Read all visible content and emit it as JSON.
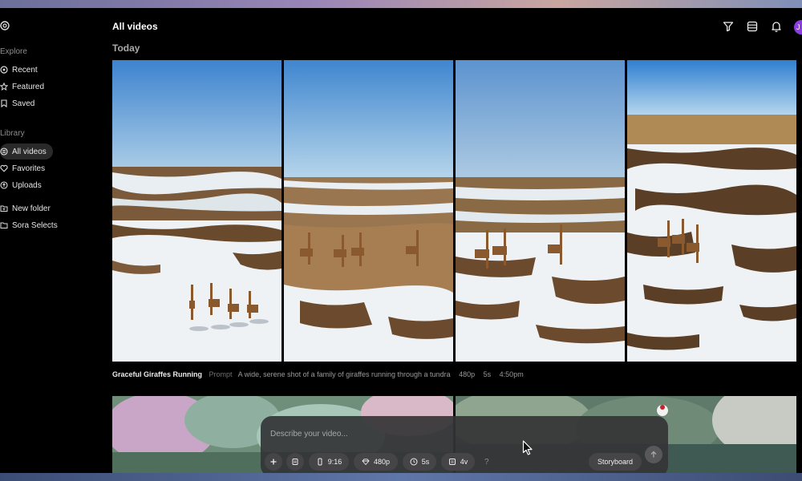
{
  "sidebar": {
    "explore_label": "Explore",
    "explore_items": [
      {
        "label": "Recent",
        "icon": "recent-icon"
      },
      {
        "label": "Featured",
        "icon": "star-icon"
      },
      {
        "label": "Saved",
        "icon": "bookmark-icon"
      }
    ],
    "library_label": "Library",
    "library_items": [
      {
        "label": "All videos",
        "icon": "videos-icon",
        "active": true
      },
      {
        "label": "Favorites",
        "icon": "heart-icon"
      },
      {
        "label": "Uploads",
        "icon": "upload-icon"
      }
    ],
    "folder_items": [
      {
        "label": "New folder",
        "icon": "folder-plus-icon"
      },
      {
        "label": "Sora Selects",
        "icon": "folder-icon"
      }
    ]
  },
  "header": {
    "title": "All videos",
    "icons": [
      "filter-icon",
      "list-view-icon",
      "bell-icon"
    ],
    "avatar_initial": "J"
  },
  "section": {
    "heading": "Today"
  },
  "video": {
    "title": "Graceful Giraffes Running",
    "prompt_label": "Prompt",
    "prompt": "A wide, serene shot of a family of giraffes running through a tundra",
    "resolution": "480p",
    "duration": "5s",
    "time": "4:50pm"
  },
  "composer": {
    "placeholder": "Describe your video...",
    "add_icon": "plus-icon",
    "aspect_ratio": "9:16",
    "resolution": "480p",
    "duration": "5s",
    "variations": "4v",
    "help": "?",
    "storyboard": "Storyboard",
    "submit_icon": "arrow-up-icon"
  },
  "colors": {
    "accent_avatar": "#8c3de0",
    "background": "#000000",
    "composer": "#343436"
  }
}
